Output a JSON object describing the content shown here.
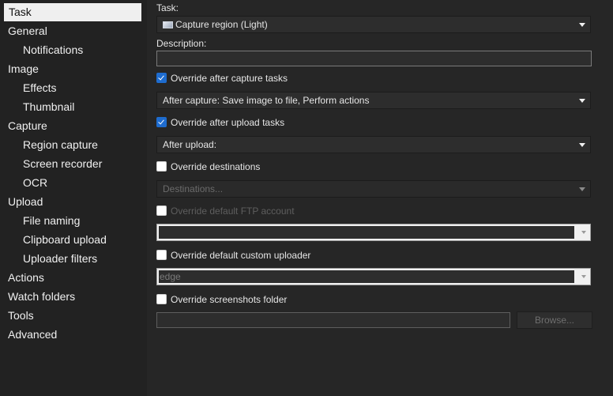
{
  "sidebar": {
    "items": [
      {
        "label": "Task",
        "level": 0,
        "selected": true
      },
      {
        "label": "General",
        "level": 0
      },
      {
        "label": "Notifications",
        "level": 1
      },
      {
        "label": "Image",
        "level": 0
      },
      {
        "label": "Effects",
        "level": 1
      },
      {
        "label": "Thumbnail",
        "level": 1
      },
      {
        "label": "Capture",
        "level": 0
      },
      {
        "label": "Region capture",
        "level": 1
      },
      {
        "label": "Screen recorder",
        "level": 1
      },
      {
        "label": "OCR",
        "level": 1
      },
      {
        "label": "Upload",
        "level": 0
      },
      {
        "label": "File naming",
        "level": 1
      },
      {
        "label": "Clipboard upload",
        "level": 1
      },
      {
        "label": "Uploader filters",
        "level": 1
      },
      {
        "label": "Actions",
        "level": 0
      },
      {
        "label": "Watch folders",
        "level": 0
      },
      {
        "label": "Tools",
        "level": 0
      },
      {
        "label": "Advanced",
        "level": 0
      }
    ]
  },
  "task": {
    "label": "Task:",
    "value": "Capture region (Light)",
    "icon": "capture-region-icon"
  },
  "description": {
    "label": "Description:",
    "value": ""
  },
  "after_capture": {
    "override_label": "Override after capture tasks",
    "override_checked": true,
    "value": "After capture: Save image to file, Perform actions"
  },
  "after_upload": {
    "override_label": "Override after upload tasks",
    "override_checked": true,
    "value": "After upload:"
  },
  "destinations": {
    "override_label": "Override destinations",
    "override_checked": false,
    "value": "Destinations..."
  },
  "ftp": {
    "override_label": "Override default FTP account",
    "override_checked": false,
    "value": ""
  },
  "custom_uploader": {
    "override_label": "Override default custom uploader",
    "override_checked": false,
    "value": "edge"
  },
  "screenshots_folder": {
    "override_label": "Override screenshots folder",
    "override_checked": false,
    "value": "",
    "browse_label": "Browse..."
  }
}
